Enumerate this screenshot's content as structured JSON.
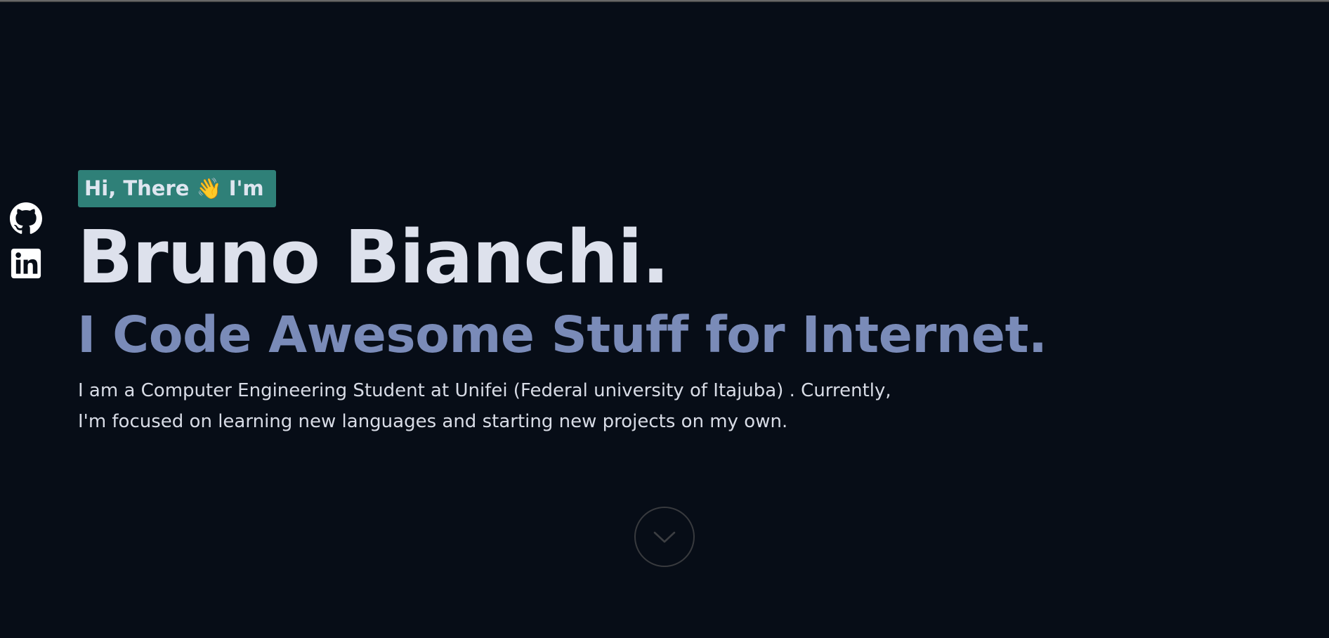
{
  "social": {
    "items": [
      {
        "name": "GitHub",
        "icon": "github-icon"
      },
      {
        "name": "LinkedIn",
        "icon": "linkedin-icon"
      }
    ]
  },
  "hero": {
    "greeting": "Hi, There 👋 I'm",
    "name": "Bruno Bianchi.",
    "tagline": "I Code Awesome Stuff for Internet.",
    "bio_line1": "I am a Computer Engineering Student at Unifei (Federal university of Itajuba) . Currently,",
    "bio_line2": "I'm focused on learning new languages and starting new projects on my own."
  },
  "scroll": {
    "icon": "chevron-down-icon"
  },
  "colors": {
    "background": "#070d17",
    "greeting_bg": "#2f8078",
    "name": "#dde1ec",
    "tagline": "#7a8bb8",
    "bio": "#d8dce6"
  }
}
